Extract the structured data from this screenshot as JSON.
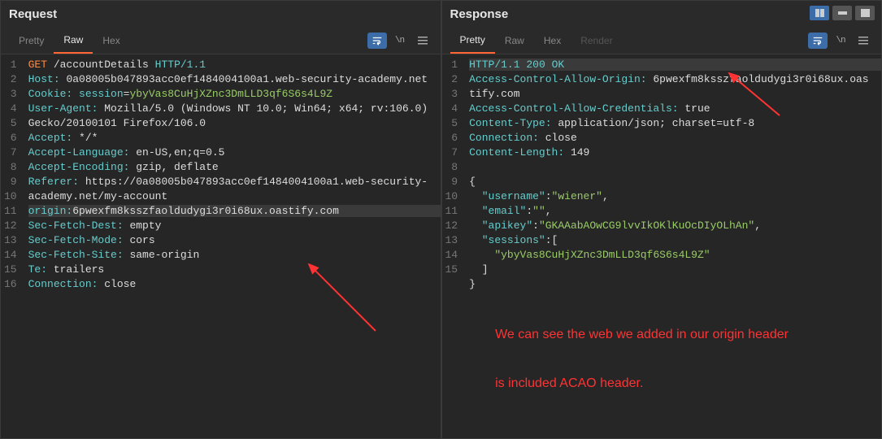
{
  "request": {
    "title": "Request",
    "tabs": [
      "Pretty",
      "Raw",
      "Hex"
    ],
    "active_tab": "Raw",
    "lines": {
      "l1": {
        "method": "GET",
        "path": "/accountDetails",
        "proto": "HTTP/1.1"
      },
      "l2": {
        "h": "Host:",
        "v": "0a08005b047893acc0ef1484004100a1.web-security-academy.net"
      },
      "l3": {
        "h": "Cookie:",
        "k": "session",
        "v": "ybyVas8CuHjXZnc3DmLLD3qf6S6s4L9Z"
      },
      "l4": {
        "h": "User-Agent:",
        "v": "Mozilla/5.0 (Windows NT 10.0; Win64; x64; rv:106.0) Gecko/20100101 Firefox/106.0"
      },
      "l5": {
        "h": "Accept:",
        "v": "*/*"
      },
      "l6": {
        "h": "Accept-Language:",
        "v": "en-US,en;q=0.5"
      },
      "l7": {
        "h": "Accept-Encoding:",
        "v": "gzip, deflate"
      },
      "l8": {
        "h": "Referer:",
        "v": "https://0a08005b047893acc0ef1484004100a1.web-security-academy.net/my-account"
      },
      "l9": {
        "h": "origin:",
        "v": "6pwexfm8ksszfaoldudygi3r0i68ux.oastify.com"
      },
      "l10": {
        "h": "Sec-Fetch-Dest:",
        "v": "empty"
      },
      "l11": {
        "h": "Sec-Fetch-Mode:",
        "v": "cors"
      },
      "l12": {
        "h": "Sec-Fetch-Site:",
        "v": "same-origin"
      },
      "l13": {
        "h": "Te:",
        "v": "trailers"
      },
      "l14": {
        "h": "Connection:",
        "v": "close"
      }
    }
  },
  "response": {
    "title": "Response",
    "tabs": [
      "Pretty",
      "Raw",
      "Hex",
      "Render"
    ],
    "active_tab": "Pretty",
    "lines": {
      "l1": {
        "proto": "HTTP/1.1",
        "status": "200",
        "reason": "OK"
      },
      "l2": {
        "h": "Access-Control-Allow-Origin:",
        "v": "6pwexfm8ksszfaoldudygi3r0i68ux.oastify.com"
      },
      "l3": {
        "h": "Access-Control-Allow-Credentials:",
        "v": "true"
      },
      "l4": {
        "h": "Content-Type:",
        "v": "application/json; charset=utf-8"
      },
      "l5": {
        "h": "Connection:",
        "v": "close"
      },
      "l6": {
        "h": "Content-Length:",
        "v": "149"
      },
      "body": {
        "open": "{",
        "username_k": "\"username\"",
        "username_v": "\"wiener\"",
        "email_k": "\"email\"",
        "email_v": "\"\"",
        "apikey_k": "\"apikey\"",
        "apikey_v": "\"GKAAabAOwCG9lvvIkOKlKuOcDIyOLhAn\"",
        "sessions_k": "\"sessions\"",
        "sessions_open": "[",
        "sessions_v": "\"ybyVas8CuHjXZnc3DmLLD3qf6S6s4L9Z\"",
        "sessions_close": "]",
        "close": "}"
      }
    }
  },
  "annotation": {
    "line1": "We can see the web we added in our origin header",
    "line2": "is included ACAO header."
  },
  "gutter_req": [
    "1",
    "2",
    "",
    "3",
    "4",
    "",
    "5",
    "6",
    "7",
    "8",
    "",
    "9",
    "10",
    "11",
    "12",
    "13",
    "14",
    "15",
    "16"
  ],
  "gutter_res": [
    "1",
    "2",
    "",
    "3",
    "4",
    "5",
    "6",
    "7",
    "8",
    "9",
    "10",
    "11",
    "12",
    "13",
    "14",
    "15"
  ]
}
